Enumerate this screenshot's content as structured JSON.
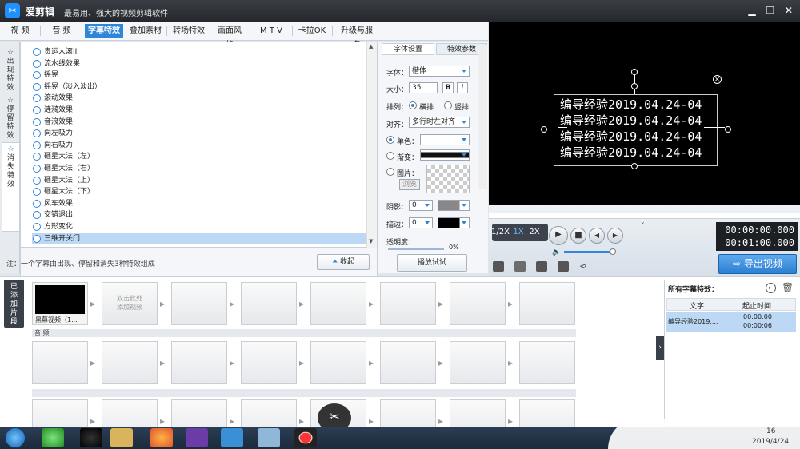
{
  "app": {
    "name": "爱剪辑",
    "slogan": "最易用、强大的视频剪辑软件"
  },
  "menu": {
    "tabs": [
      "视  频",
      "音  频",
      "字幕特效",
      "叠加素材",
      "转场特效",
      "画面风格",
      "M T V",
      "卡拉OK",
      "升级与服务"
    ],
    "active": 2
  },
  "side_tabs": [
    {
      "label": "出\n现\n特\n效"
    },
    {
      "label": "停\n留\n特\n效"
    },
    {
      "label": "消\n失\n特\n效",
      "active": true
    }
  ],
  "effects": [
    "贵运人滚II",
    "流水线效果",
    "摇晃",
    "摇晃（淡入淡出）",
    "滚动效果",
    "涟漪效果",
    "音浪效果",
    "向左吸力",
    "向右吸力",
    "砸星大法（左）",
    "砸星大法（右）",
    "砸星大法（上）",
    "砸星大法（下）",
    "风车效果",
    "交错退出",
    "方形变化",
    "三维开关门"
  ],
  "selected_effect": "三维开关门",
  "note": "注：一个字幕由出现、停留和消失3种特效组成",
  "collapse_label": "收起",
  "props": {
    "tabs": [
      "字体设置",
      "特效参数"
    ],
    "font_label": "字体：",
    "font_value": "楷体",
    "size_label": "大小：",
    "size_value": "35",
    "bold": "B",
    "italic": "I",
    "arrange_label": "排列：",
    "arrange_opts": [
      "横排",
      "竖排"
    ],
    "align_label": "对齐：",
    "align_value": "多行时左对齐",
    "mono_label": "单色：",
    "grad_label": "渐变：",
    "image_label": "图片：",
    "browse_label": "浏览",
    "shadow_label": "阴影：",
    "shadow_value": "0",
    "stroke_label": "描边：",
    "stroke_value": "0",
    "opacity_label": "透明度：",
    "opacity_pct": "0%",
    "preview_label": "播放试试"
  },
  "subtitle_lines": [
    "编导经验2019.04.24-04",
    "编导经验2019.04.24-04",
    "编导经验2019.04.24-04",
    "编导经验2019.04.24-04"
  ],
  "player": {
    "speeds": [
      "1/2X",
      "1X",
      "2X"
    ],
    "active_speed": "1X",
    "time_current": "00:00:00.000",
    "time_total": "00:01:00.000",
    "export_label": "导出视频"
  },
  "lower": {
    "added_tab": "已\n添\n加\n片\n段",
    "first_clip_label": "黑幕视频（1...",
    "add_hint": "双击此处\n添加视频",
    "audio_label": "音  频"
  },
  "right_panel": {
    "title": "所有字幕特效：",
    "col_text": "文字",
    "col_time": "起止时间",
    "row_text": "编导经验2019....",
    "row_start": "00:00:00",
    "row_end": "00:00:06"
  },
  "taskbar": {
    "time": "16",
    "date": "2019/4/24"
  }
}
